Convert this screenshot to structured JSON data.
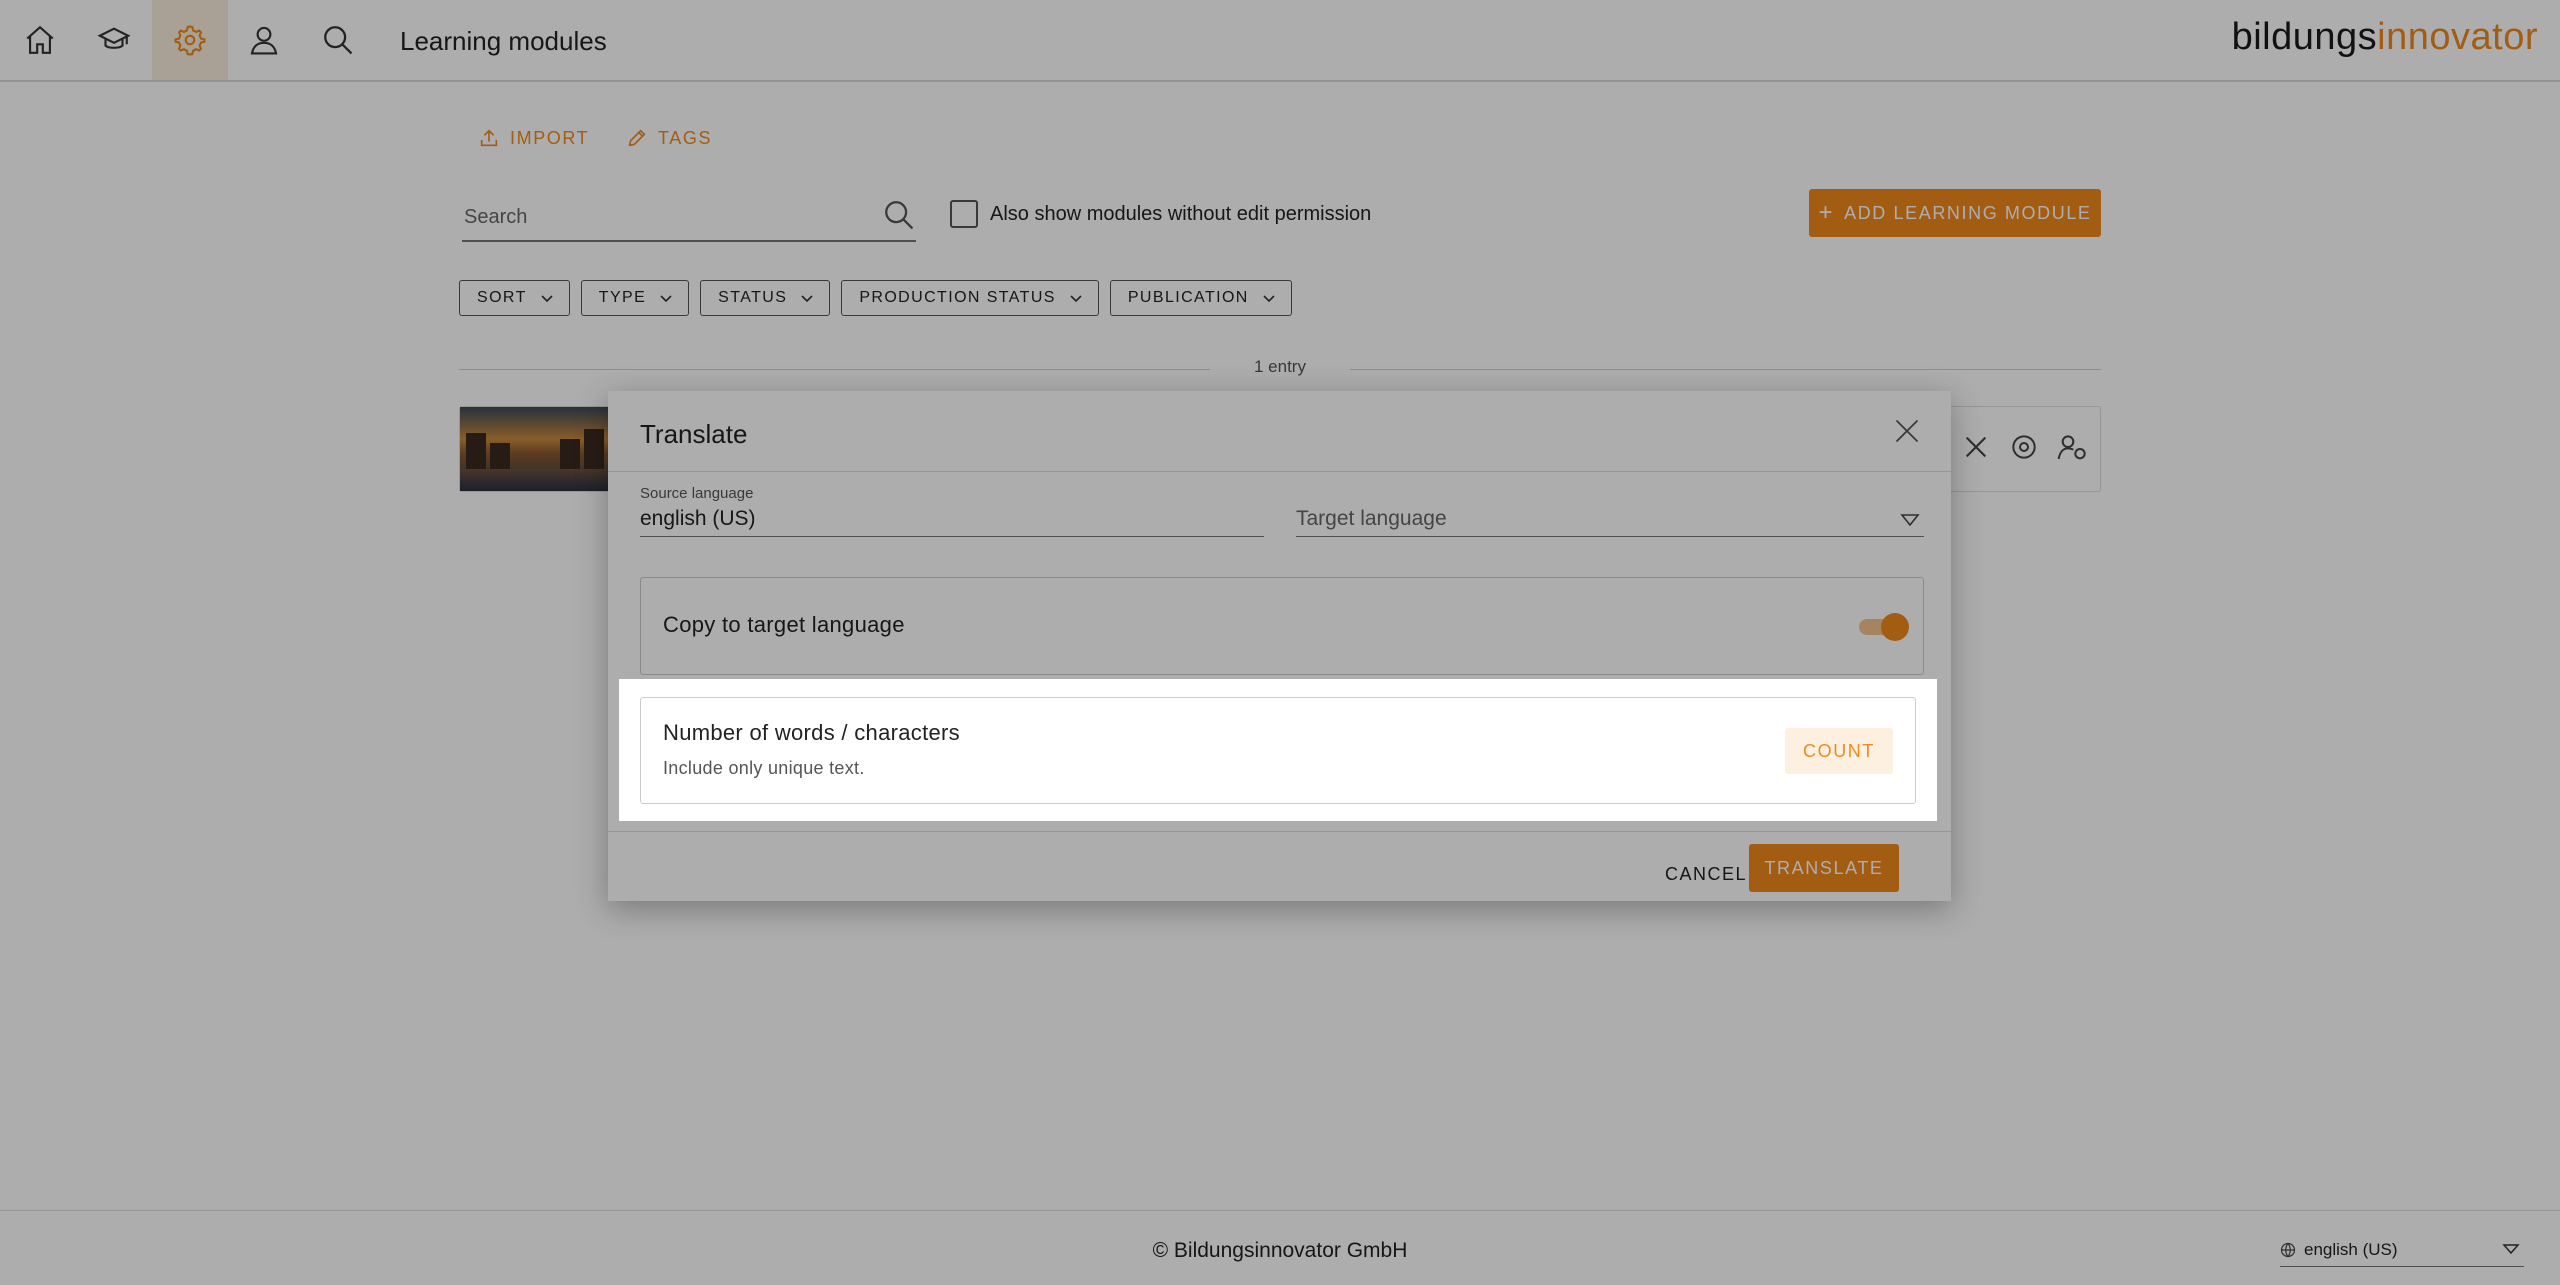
{
  "header": {
    "title": "Learning modules",
    "logo_part1": "bildungs",
    "logo_part2": "innovator",
    "nav": [
      {
        "icon": "home-icon"
      },
      {
        "icon": "graduation-cap-icon"
      },
      {
        "icon": "gear-icon",
        "active": true
      },
      {
        "icon": "user-icon"
      },
      {
        "icon": "search-icon"
      }
    ]
  },
  "toolbar": {
    "import_label": "IMPORT",
    "tags_label": "TAGS",
    "search_placeholder": "Search",
    "checkbox_label": "Also show modules without edit permission",
    "add_label": "ADD LEARNING MODULE"
  },
  "filters": [
    "SORT",
    "TYPE",
    "STATUS",
    "PRODUCTION STATUS",
    "PUBLICATION"
  ],
  "list": {
    "entry_count": "1 entry"
  },
  "dialog": {
    "title": "Translate",
    "source_label": "Source language",
    "source_value": "english (US)",
    "target_placeholder": "Target language",
    "copy_label": "Copy to target language",
    "copy_enabled": true,
    "count_title": "Number of words / characters",
    "count_subtitle": "Include only unique text.",
    "count_button": "COUNT",
    "cancel_button": "CANCEL",
    "translate_button": "TRANSLATE"
  },
  "footer": {
    "copyright": "© Bildungsinnovator GmbH",
    "language": "english (US)"
  },
  "colors": {
    "accent": "#f08a1c",
    "accent_light": "#fdf0e0",
    "overlay": "rgba(0,0,0,0.32)"
  }
}
